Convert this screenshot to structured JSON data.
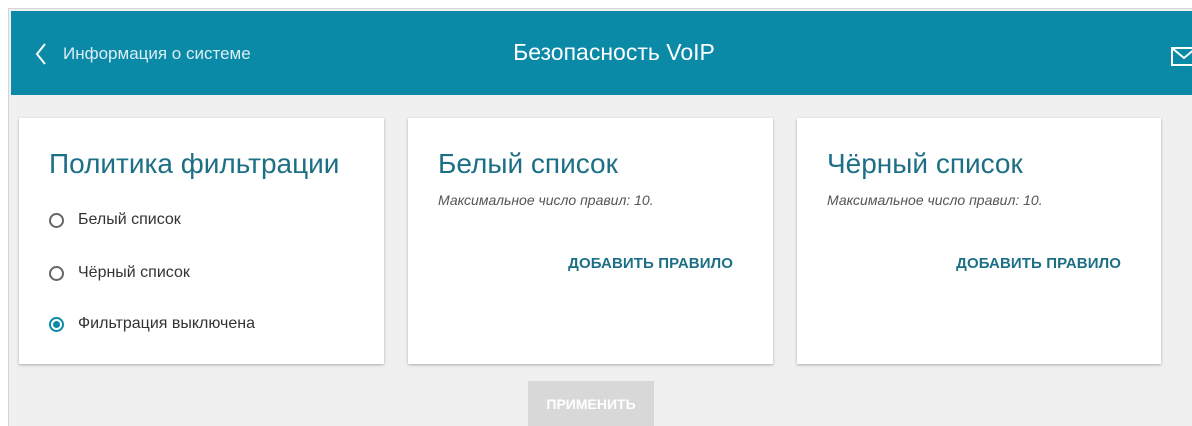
{
  "header": {
    "back_label": "Информация о системе",
    "title": "Безопасность VoIP",
    "color": "#0b8aa8"
  },
  "policy": {
    "title": "Политика фильтрации",
    "options": [
      {
        "label": "Белый список",
        "selected": false
      },
      {
        "label": "Чёрный список",
        "selected": false
      },
      {
        "label": "Фильтрация выключена",
        "selected": true
      }
    ]
  },
  "whitelist": {
    "title": "Белый список",
    "note": "Максимальное число правил: 10.",
    "add_label": "ДОБАВИТЬ ПРАВИЛО"
  },
  "blacklist": {
    "title": "Чёрный список",
    "note": "Максимальное число правил: 10.",
    "add_label": "ДОБАВИТЬ ПРАВИЛО"
  },
  "apply_label": "ПРИМЕНИТЬ",
  "icons": {
    "back": "chevron-left-icon",
    "mail": "envelope-icon"
  }
}
